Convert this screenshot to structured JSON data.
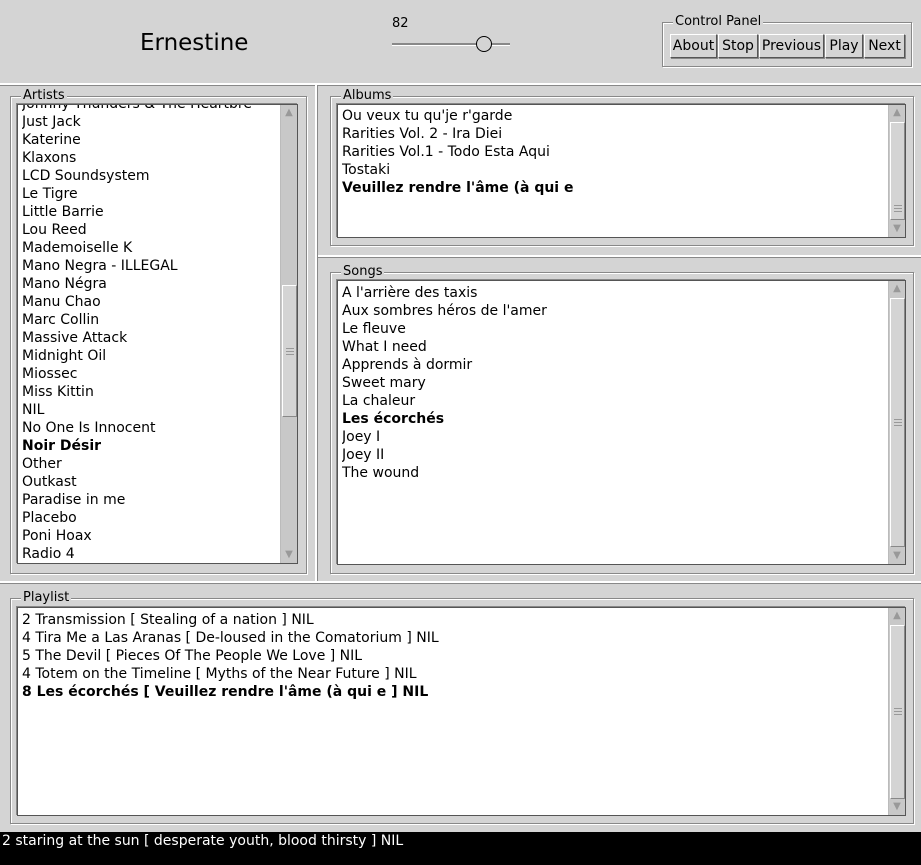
{
  "app": {
    "title": "Ernestine"
  },
  "volume": {
    "label": "82",
    "value": 82
  },
  "control_panel": {
    "legend": "Control Panel",
    "buttons": {
      "about": "About",
      "stop": "Stop",
      "previous": "Previous",
      "play": "Play",
      "next": "Next"
    }
  },
  "artists": {
    "legend": "Artists",
    "items": [
      "Johnny Thunders & The Heartbre",
      "Just Jack",
      "Katerine",
      "Klaxons",
      "LCD Soundsystem",
      "Le Tigre",
      "Little Barrie",
      "Lou Reed",
      "Mademoiselle K",
      "Mano Negra - ILLEGAL",
      "Mano Négra",
      "Manu Chao",
      "Marc Collin",
      "Massive Attack",
      "Midnight Oil",
      "Miossec",
      "Miss Kittin",
      "NIL",
      "No One Is Innocent",
      "Noir Désir",
      "Other",
      "Outkast",
      "Paradise in me",
      "Placebo",
      "Poni Hoax",
      "Radio 4"
    ],
    "selected": "Noir Désir"
  },
  "albums": {
    "legend": "Albums",
    "items": [
      "Ou veux tu qu'je r'garde",
      "Rarities Vol. 2 - Ira Diei",
      "Rarities Vol.1 - Todo Esta Aqui",
      "Tostaki",
      "Veuillez rendre l'âme (à qui e"
    ],
    "selected": "Veuillez rendre l'âme (à qui e"
  },
  "songs": {
    "legend": "Songs",
    "items": [
      "A l'arrière des taxis",
      "Aux sombres héros de l'amer",
      "Le fleuve",
      "What I need",
      "Apprends à dormir",
      "Sweet mary",
      "La chaleur",
      "Les écorchés",
      "Joey I",
      "Joey II",
      "The wound"
    ],
    "selected": "Les écorchés"
  },
  "playlist": {
    "legend": "Playlist",
    "items": [
      "2 Transmission [ Stealing of a nation ] NIL",
      "4 Tira Me a Las Aranas [ De-loused in the Comatorium ] NIL",
      "5 The Devil [ Pieces Of The People We Love ] NIL",
      "4 Totem on the Timeline [ Myths of the Near Future ] NIL",
      "8 Les écorchés [ Veuillez rendre l'âme (à qui e ] NIL"
    ],
    "selected": "8 Les écorchés [ Veuillez rendre l'âme (à qui e ] NIL"
  },
  "status": {
    "text": "2 staring at the sun [ desperate youth, blood thirsty ] NIL"
  },
  "icons": {
    "scroll_up": "scroll-up-arrow-icon",
    "scroll_down": "scroll-down-arrow-icon"
  }
}
